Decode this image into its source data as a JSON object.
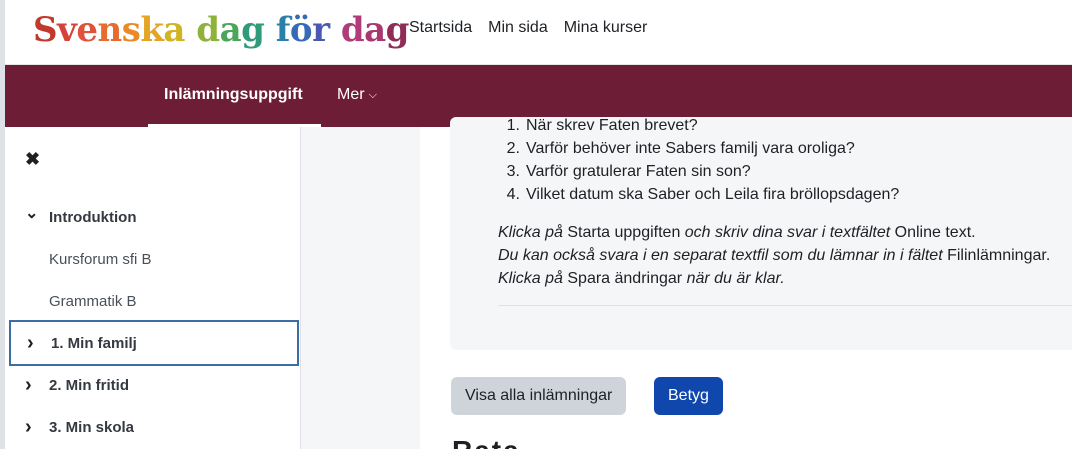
{
  "logo": {
    "parts": [
      {
        "text": "S",
        "color": "#c0392b"
      },
      {
        "text": "v",
        "color": "#d6413a"
      },
      {
        "text": "e",
        "color": "#e0533a"
      },
      {
        "text": "n",
        "color": "#e76b2f"
      },
      {
        "text": "s",
        "color": "#ea8a27"
      },
      {
        "text": "k",
        "color": "#e3a524"
      },
      {
        "text": "a",
        "color": "#d2b322"
      },
      {
        "text": " ",
        "color": "#000000"
      },
      {
        "text": "d",
        "color": "#8fb33a"
      },
      {
        "text": "a",
        "color": "#4aa65a"
      },
      {
        "text": "g",
        "color": "#2f9b7a"
      },
      {
        "text": " ",
        "color": "#000000"
      },
      {
        "text": "f",
        "color": "#2b7fa8"
      },
      {
        "text": "ö",
        "color": "#3769b6"
      },
      {
        "text": "r",
        "color": "#4a57b4"
      },
      {
        "text": " ",
        "color": "#000000"
      },
      {
        "text": "d",
        "color": "#b03a7a"
      },
      {
        "text": "a",
        "color": "#a8386f"
      },
      {
        "text": "g",
        "color": "#8e2d55"
      }
    ]
  },
  "topnav": {
    "items": [
      "Startsida",
      "Min sida",
      "Mina kurser"
    ]
  },
  "secnav": {
    "active_tab": "Inlämningsuppgift",
    "more_label": "Mer",
    "more_icon": "chevron-down-icon"
  },
  "drawer": {
    "close_icon": "close-icon",
    "items": [
      {
        "label": "Introduktion",
        "type": "section",
        "icon": "chevron-down-icon",
        "glyph": "⌄"
      },
      {
        "label": "Kursforum sfi B",
        "type": "sub"
      },
      {
        "label": "Grammatik B",
        "type": "sub"
      },
      {
        "label": "1. Min familj",
        "type": "section",
        "icon": "chevron-right-icon",
        "glyph": "›",
        "focused": true
      },
      {
        "label": "2. Min fritid",
        "type": "section",
        "icon": "chevron-right-icon",
        "glyph": "›"
      },
      {
        "label": "3. Min skola",
        "type": "section",
        "icon": "chevron-right-icon",
        "glyph": "›"
      }
    ]
  },
  "assignment": {
    "questions": [
      {
        "num": "1.",
        "text": "När skrev Faten brevet?"
      },
      {
        "num": "2.",
        "text": "Varför behöver inte Sabers familj vara oroliga?"
      },
      {
        "num": "3.",
        "text": "Varför gratulerar Faten sin son?"
      },
      {
        "num": "4.",
        "text": "Vilket datum ska Saber och Leila fira bröllopsdagen?"
      }
    ],
    "instructions": {
      "line1": {
        "i1": "Klicka på",
        "t1": " Starta uppgiften ",
        "i2": "och skriv dina svar i textfältet",
        "t2": " Online text."
      },
      "line2": {
        "i1": "Du kan också svara i en separat textfil som du lämnar in i fältet",
        "t1": " Filinlämningar."
      },
      "line3": {
        "i1": "Klicka på",
        "t1": " Spara ändringar ",
        "i2": "när du är klar."
      }
    }
  },
  "actions": {
    "view_all": "Visa alla inlämningar",
    "grade": "Betyg"
  },
  "partial_heading": "Rata........"
}
